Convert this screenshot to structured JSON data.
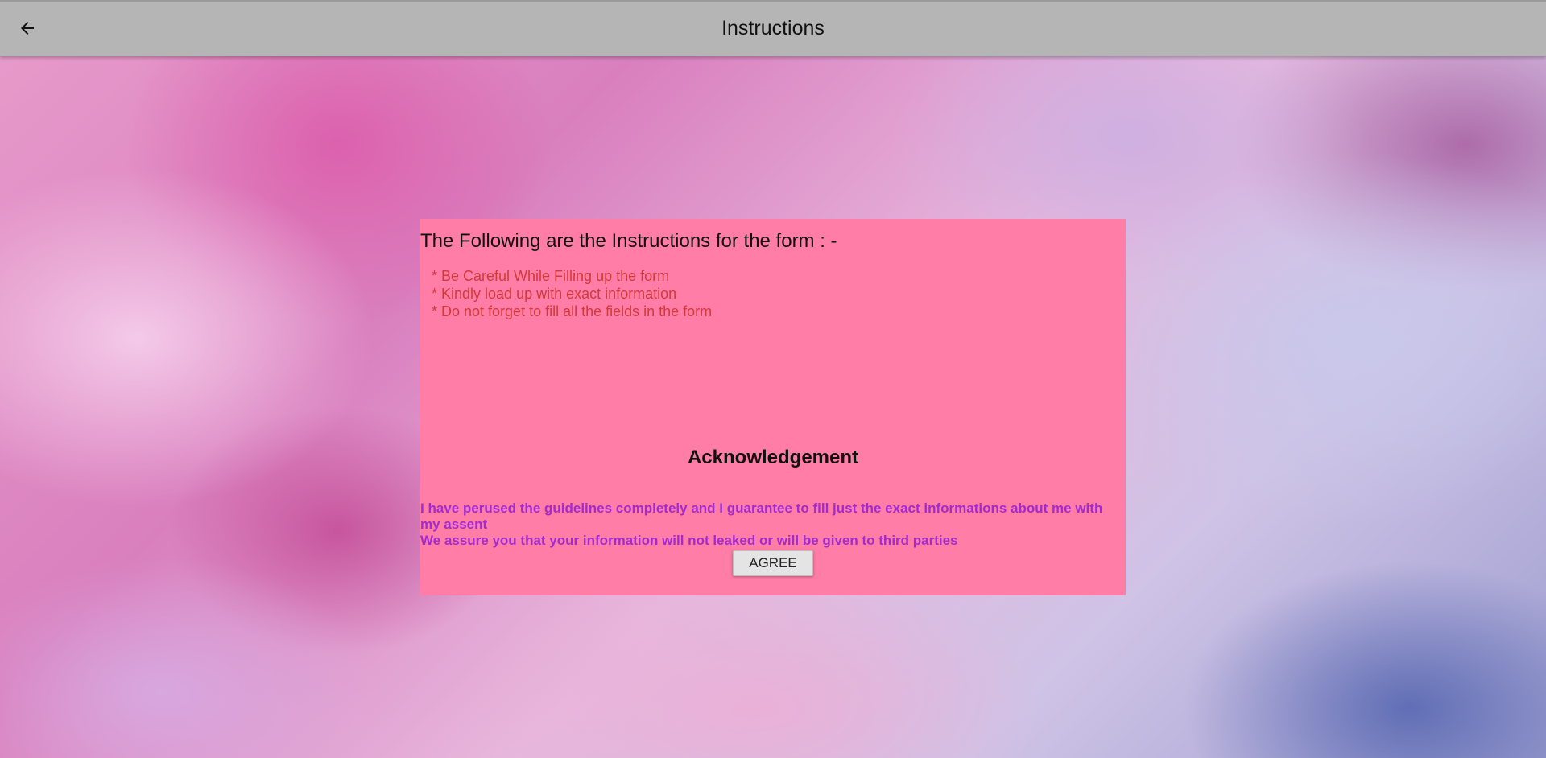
{
  "appbar": {
    "title": "Instructions",
    "back_icon": "arrow-left-icon"
  },
  "card": {
    "heading": "The Following are the Instructions for the form : -",
    "instructions": [
      "* Be Careful While Filling up the form",
      "* Kindly load up with exact information",
      "* Do not forget to fill all the fields in the form"
    ],
    "ack_title": "Acknowledgement",
    "ack_line1": " I have perused the guidelines completely and I guarantee to fill just the exact informations about me with my assent",
    "ack_line2": "We assure you that your information will not leaked or will be given to third parties",
    "agree_label": "AGREE"
  },
  "colors": {
    "appbar_bg": "#b5b5b5",
    "card_bg": "#ff7da6",
    "instruction_text": "#d23a3a",
    "ack_text": "#a12bd0"
  }
}
